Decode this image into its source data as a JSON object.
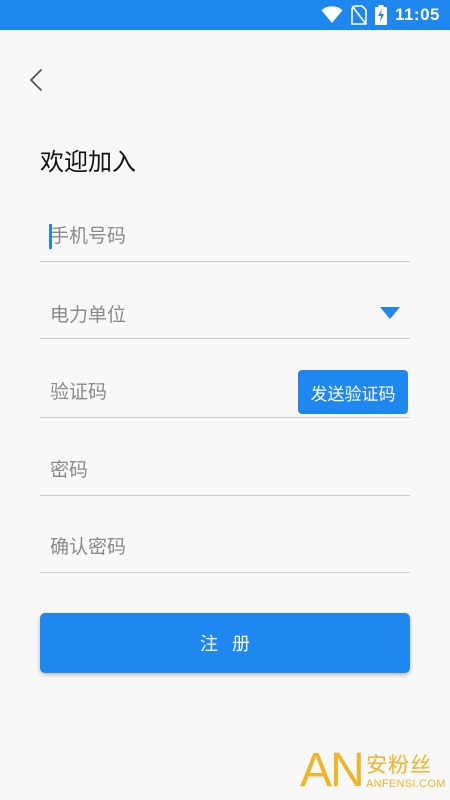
{
  "status_bar": {
    "time": "11:05",
    "icons": [
      "wifi-icon",
      "no-sim-icon",
      "battery-charging-icon"
    ],
    "color": "#1e87f0"
  },
  "header": {
    "back_icon": "chevron-left-icon",
    "title": "欢迎加入"
  },
  "form": {
    "phone": {
      "placeholder": "手机号码",
      "value": ""
    },
    "unit": {
      "label": "电力单位",
      "icon": "triangle-down-icon"
    },
    "code": {
      "placeholder": "验证码",
      "value": "",
      "send_button": "发送验证码"
    },
    "password": {
      "placeholder": "密码",
      "value": ""
    },
    "confirm_password": {
      "placeholder": "确认密码",
      "value": ""
    }
  },
  "actions": {
    "register_label": "注册"
  },
  "watermark": {
    "logo_letters": "AN",
    "cn_text": "安粉丝",
    "en_text": "ANFENSI.COM"
  },
  "colors": {
    "accent": "#1e87f0",
    "background": "#f8f8f8",
    "watermark": "#f0b429"
  }
}
